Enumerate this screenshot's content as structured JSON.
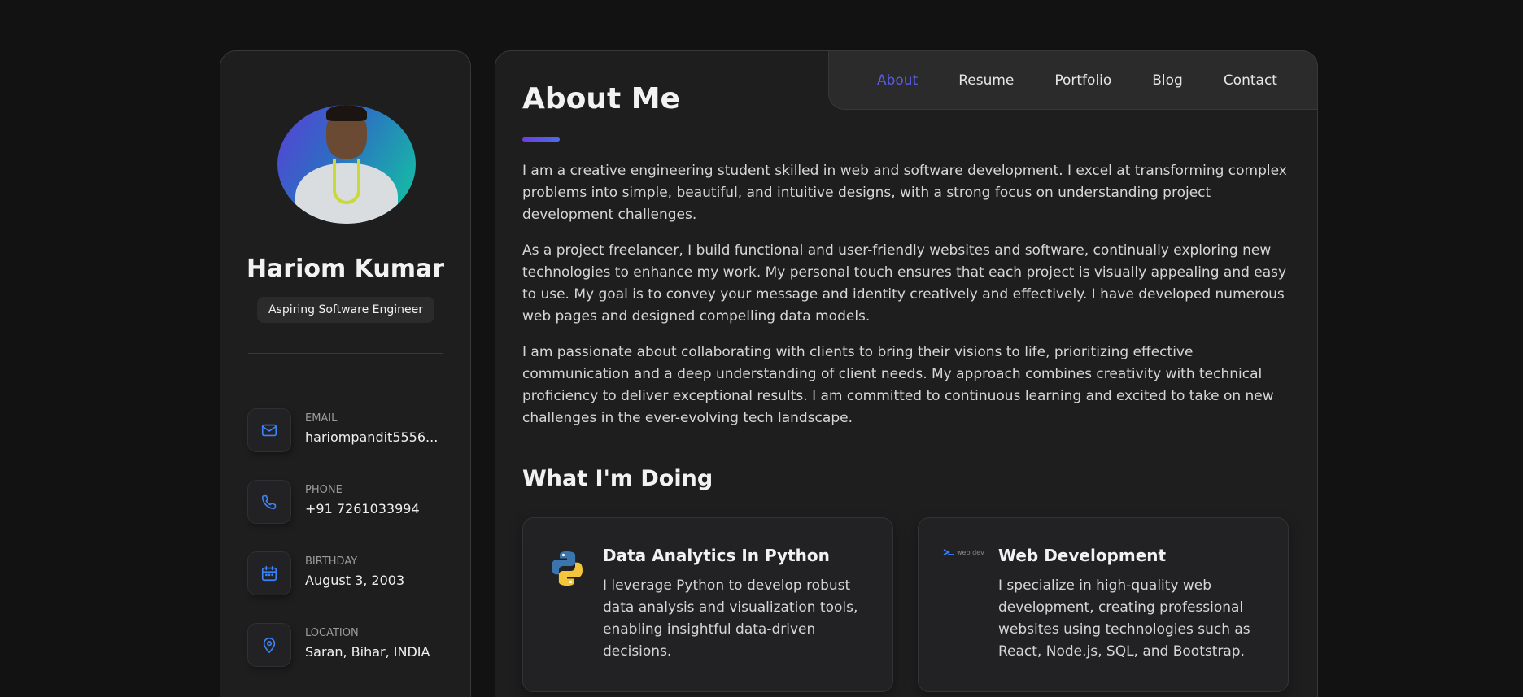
{
  "profile": {
    "name": "Hariom Kumar",
    "role": "Aspiring Software Engineer",
    "contacts": [
      {
        "label": "EMAIL",
        "value": "hariompandit5556...",
        "icon": "mail-icon"
      },
      {
        "label": "PHONE",
        "value": "+91 7261033994",
        "icon": "phone-icon"
      },
      {
        "label": "BIRTHDAY",
        "value": "August 3, 2003",
        "icon": "calendar-icon"
      },
      {
        "label": "LOCATION",
        "value": "Saran, Bihar, INDIA",
        "icon": "location-pin-icon"
      }
    ]
  },
  "nav": {
    "items": [
      "About",
      "Resume",
      "Portfolio",
      "Blog",
      "Contact"
    ],
    "active": "About"
  },
  "about": {
    "title": "About Me",
    "paragraphs": [
      "I am a creative engineering student skilled in web and software development. I excel at transforming complex problems into simple, beautiful, and intuitive designs, with a strong focus on understanding project development challenges.",
      "As a project freelancer, I build functional and user-friendly websites and software, continually exploring new technologies to enhance my work. My personal touch ensures that each project is visually appealing and easy to use. My goal is to convey your message and identity creatively and effectively. I have developed numerous web pages and designed compelling data models.",
      "I am passionate about collaborating with clients to bring their visions to life, prioritizing effective communication and a deep understanding of client needs. My approach combines creativity with technical proficiency to deliver exceptional results. I am committed to continuous learning and excited to take on new challenges in the ever-evolving tech landscape."
    ]
  },
  "doing": {
    "title": "What I'm Doing",
    "services": [
      {
        "title": "Data Analytics In Python",
        "text": "I leverage Python to develop robust data analysis and visualization tools, enabling insightful data-driven decisions.",
        "icon": "python-logo-icon"
      },
      {
        "title": "Web Development",
        "text": "I specialize in high-quality web development, creating professional websites using technologies such as React, Node.js, SQL, and Bootstrap.",
        "icon": "web-dev-logo-icon",
        "icon_text": "web dev"
      }
    ]
  },
  "colors": {
    "background": "#121212",
    "card": "#1e1e1f",
    "accent": "#5b5be8",
    "icon_blue": "#3b82f6"
  }
}
